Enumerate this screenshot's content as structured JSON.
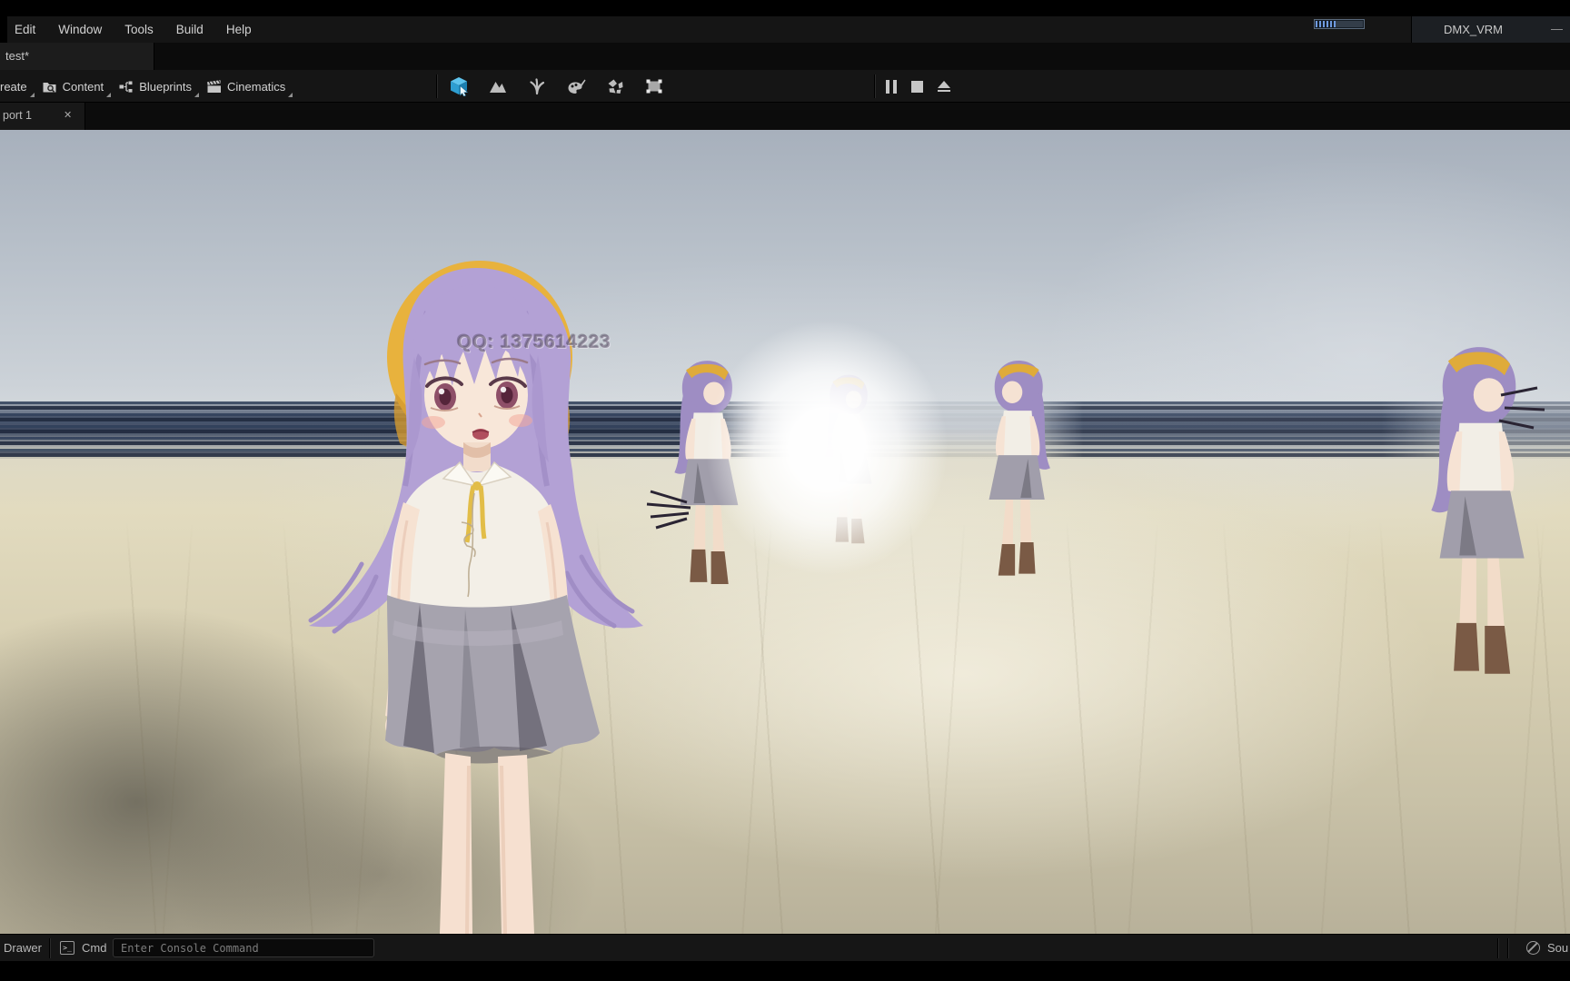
{
  "window": {
    "project_title": "DMX_VRM",
    "minimize_glyph": "—"
  },
  "menu_bar": {
    "items": [
      "Edit",
      "Window",
      "Tools",
      "Build",
      "Help"
    ]
  },
  "asset_tab_bar": {
    "active_tab": "test*"
  },
  "toolbar": {
    "create_label": "reate",
    "content_label": "Content",
    "blueprints_label": "Blueprints",
    "cinematics_label": "Cinematics",
    "mode_icons": [
      "select-mode-icon",
      "landscape-mode-icon",
      "foliage-mode-icon",
      "mesh-paint-mode-icon",
      "fracture-mode-icon",
      "modeling-mode-icon"
    ],
    "play_controls": [
      "pause",
      "stop",
      "eject"
    ]
  },
  "viewport_tab_bar": {
    "active_tab": "port 1",
    "close_glyph": "✕"
  },
  "viewport": {
    "watermark": "QQ: 1375614223"
  },
  "status_bar": {
    "drawer_label": "Drawer",
    "cmd_label": "Cmd",
    "cmd_icon_glyph": ">_",
    "console_placeholder": "Enter Console Command",
    "source_control_label": "Sou"
  },
  "colors": {
    "mode_active_blue": "#41b2e2",
    "hat_yellow": "#e8b23d",
    "hair_purple": "#b3a1d5",
    "horizon_navy": "#24344e",
    "chrome_bg": "#151515"
  }
}
